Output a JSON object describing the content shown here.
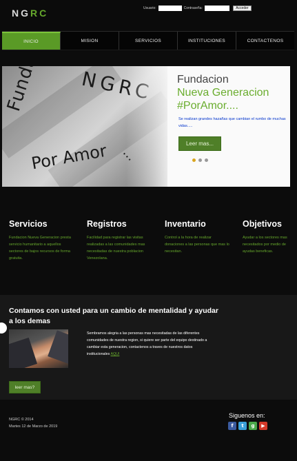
{
  "header": {
    "logo_part1": "NG",
    "logo_part2": "RC",
    "user_label": "Usuario:",
    "pass_label": "Contraseña:",
    "login_button": "Acceder",
    "user_value": "",
    "pass_value": ""
  },
  "nav": {
    "items": [
      "INICIO",
      "MISION",
      "SERVICIOS",
      "INSTITUCIONES",
      "CONTACTENOS"
    ],
    "active": "INICIO"
  },
  "hero": {
    "shirt_text": [
      "Fundación",
      "NGRC",
      "Por Amor",
      "..."
    ],
    "title_line1": "Fundacion",
    "title_line2": "Nueva Generacion",
    "title_line3": "#PorAmor....",
    "tagline": "Se realizan grandes hazañas que cambian el rumbo de muchas vidas.....",
    "cta_label": "Leer mas...",
    "slide_count": 3,
    "active_slide": 1
  },
  "features": [
    {
      "title": "Servicios",
      "text": "Fundacion Nueva Generacion presta servicio humanitario a aquellos sectores de bajos recursos de forma gratuita."
    },
    {
      "title": "Registros",
      "text": "Facilidad para registrar las visitas realizadas a las comunidades mas necesitadas de nuestra poblacion Venezolana."
    },
    {
      "title": "Inventario",
      "text": "Control a la hora de realizar donaciones a las personas que mas lo necesitan."
    },
    {
      "title": "Objetivos",
      "text": "Ayudar a los sectores mas necesitados por medio de ayudas beneficas."
    }
  ],
  "band": {
    "heading": "Contamos con usted para un cambio de mentalidad y ayudar a los demas",
    "paragraph": "Sembramos alegria a las personas mas necesitadas de las diferentes comunidades de nuestra region, si quiere ser parte del equipo destinado a cambiar esta generacion, contactenos a traves de nuestros datos institucionales",
    "link_text": "AQUI",
    "button_label": "leer mas?"
  },
  "footer": {
    "copyright": "NGRC © 2014",
    "date": "Martes 12 de Marzo de 2019",
    "follow_label": "Siguenos en:",
    "social_icons": [
      "facebook-icon",
      "twitter-icon",
      "google-icon",
      "youtube-icon"
    ]
  },
  "colors": {
    "accent": "#66a82c",
    "button": "#4f7f28",
    "background": "#0c0c0c",
    "band": "#181818",
    "tagline": "#0033cc"
  }
}
